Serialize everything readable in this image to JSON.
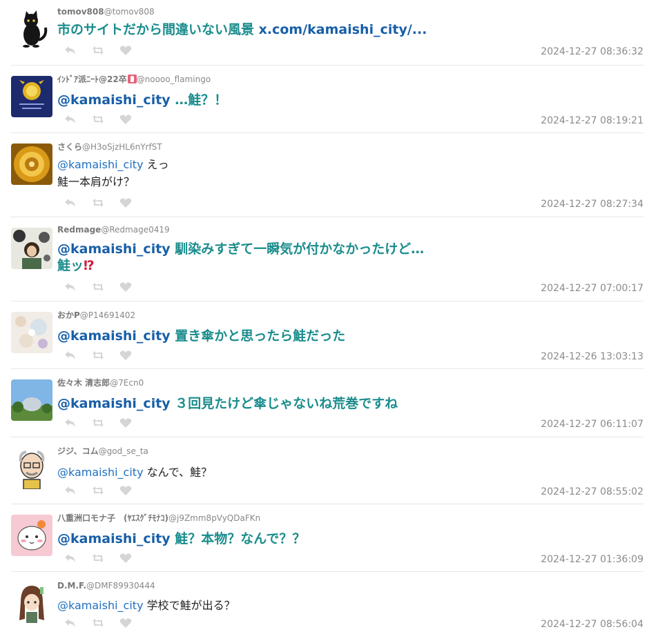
{
  "tweets": [
    {
      "author": "tomov808",
      "handle": "@tomov808",
      "mention": "",
      "text": "市のサイトだから間違いない風景 ",
      "link": "x.com/kamaishi_city/...",
      "text2": "",
      "emph": "",
      "timestamp": "2024-12-27 08:36:32",
      "style": "big",
      "avatar_icon": "black-cat-avatar"
    },
    {
      "author": "ｲﾝﾄﾞｱ派ﾆｰﾄ@22卒",
      "author_badge": "person-badge-icon",
      "handle": "@noooo_flamingo",
      "mention": "@kamaishi_city",
      "text": " …鮭？！",
      "timestamp": "2024-12-27 08:19:21",
      "style": "big",
      "avatar_icon": "emblem-avatar"
    },
    {
      "author": "さくら",
      "handle": "@H3oSjzHL6nYrfST",
      "mention": "@kamaishi_city",
      "text": " えっ\n鮭一本肩がけ？",
      "timestamp": "2024-12-27 08:27:34",
      "style": "small",
      "avatar_icon": "golden-sun-avatar"
    },
    {
      "author": "Redmage",
      "handle": "@Redmage0419",
      "mention": "@kamaishi_city",
      "text": " 馴染みすぎて一瞬気が付かなかったけど…\n鮭ッ",
      "emph": "⁉",
      "timestamp": "2024-12-27 07:00:17",
      "style": "big",
      "avatar_icon": "portrait-avatar"
    },
    {
      "author": "おかP",
      "handle": "@P14691402",
      "mention": "@kamaishi_city",
      "text": " 置き傘かと思ったら鮭だった",
      "timestamp": "2024-12-26 13:03:13",
      "style": "big",
      "avatar_icon": "floral-avatar"
    },
    {
      "author": "佐々木 清志郎",
      "handle": "@7Ecn0",
      "mention": "@kamaishi_city",
      "text": " ３回見たけど傘じゃないね荒巻ですね",
      "timestamp": "2024-12-27 06:11:07",
      "style": "big",
      "avatar_icon": "sky-avatar"
    },
    {
      "author": "ジジ、コム",
      "handle": "@god_se_ta",
      "mention": "@kamaishi_city",
      "text": " なんで、鮭？",
      "timestamp": "2024-12-27 08:55:02",
      "style": "small",
      "avatar_icon": "old-man-avatar"
    },
    {
      "author": "八重洲口モナ子　(ﾔｴｽｸﾞﾁﾓﾅｺ)",
      "handle": "@j9Zmm8pVyQDaFKn",
      "mention": "@kamaishi_city",
      "text": " 鮭？本物？なんで？？",
      "timestamp": "2024-12-27 01:36:09",
      "style": "big",
      "avatar_icon": "pink-character-avatar"
    },
    {
      "author": "D.M.F.",
      "handle": "@DMF89930444",
      "mention": "@kamaishi_city",
      "text": " 学校で鮭が出る？",
      "timestamp": "2024-12-27 08:56:04",
      "style": "small",
      "avatar_icon": "anime-girl-avatar"
    }
  ],
  "icons": {
    "reply": "reply-icon",
    "retweet": "retweet-icon",
    "like": "heart-icon"
  },
  "colors": {
    "big_text": "#1a8c8c",
    "mention": "#1e6fc0",
    "timestamp": "#8a8a8a",
    "action_icons": "#d5d5d5"
  }
}
